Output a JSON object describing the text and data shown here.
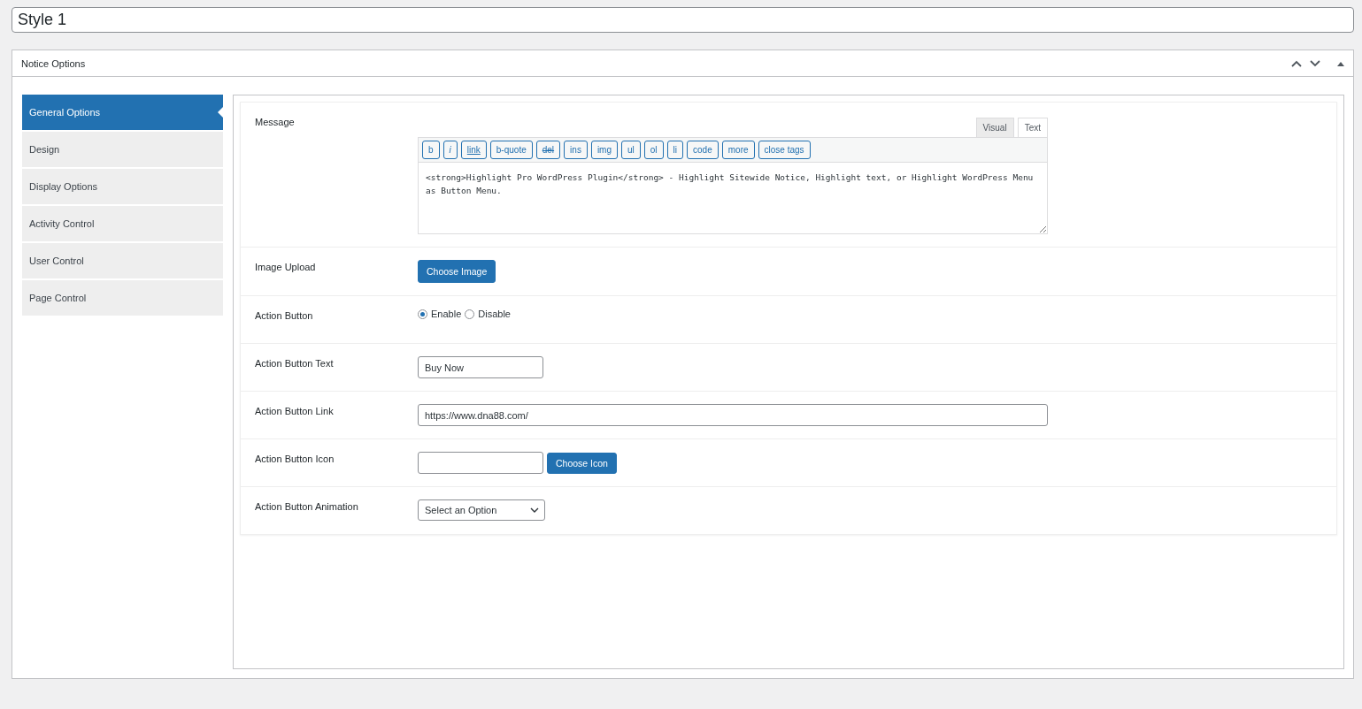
{
  "title_field": {
    "value": "Style 1"
  },
  "postbox": {
    "title": "Notice Options"
  },
  "sidebar": {
    "items": [
      {
        "label": "General Options",
        "selected": true
      },
      {
        "label": "Design",
        "selected": false
      },
      {
        "label": "Display Options",
        "selected": false
      },
      {
        "label": "Activity Control",
        "selected": false
      },
      {
        "label": "User Control",
        "selected": false
      },
      {
        "label": "Page Control",
        "selected": false
      }
    ]
  },
  "fields": [
    {
      "kind": "editor",
      "label": "Message",
      "tabs": [
        {
          "label": "Visual",
          "selected": false
        },
        {
          "label": "Text",
          "selected": true
        }
      ],
      "quicktags": [
        "b",
        "i",
        "link",
        "b-quote",
        "del",
        "ins",
        "img",
        "ul",
        "ol",
        "li",
        "code",
        "more",
        "close tags"
      ],
      "value": "<strong>Highlight Pro WordPress Plugin</strong> - Highlight Sitewide Notice, Highlight text, or Highlight WordPress Menu as Button Menu."
    },
    {
      "kind": "button",
      "label": "Image Upload",
      "button": "Choose Image"
    },
    {
      "kind": "radio",
      "label": "Action Button",
      "options": [
        {
          "label": "Enable",
          "selected": true
        },
        {
          "label": "Disable",
          "selected": false
        }
      ]
    },
    {
      "kind": "text",
      "label": "Action Button Text",
      "value": "Buy Now",
      "wide": false
    },
    {
      "kind": "text",
      "label": "Action Button Link",
      "value": "https://www.dna88.com/",
      "wide": true
    },
    {
      "kind": "picker",
      "label": "Action Button Icon",
      "button": "Choose Icon"
    },
    {
      "kind": "select",
      "label": "Action Button Animation",
      "value": "Select an Option"
    }
  ]
}
